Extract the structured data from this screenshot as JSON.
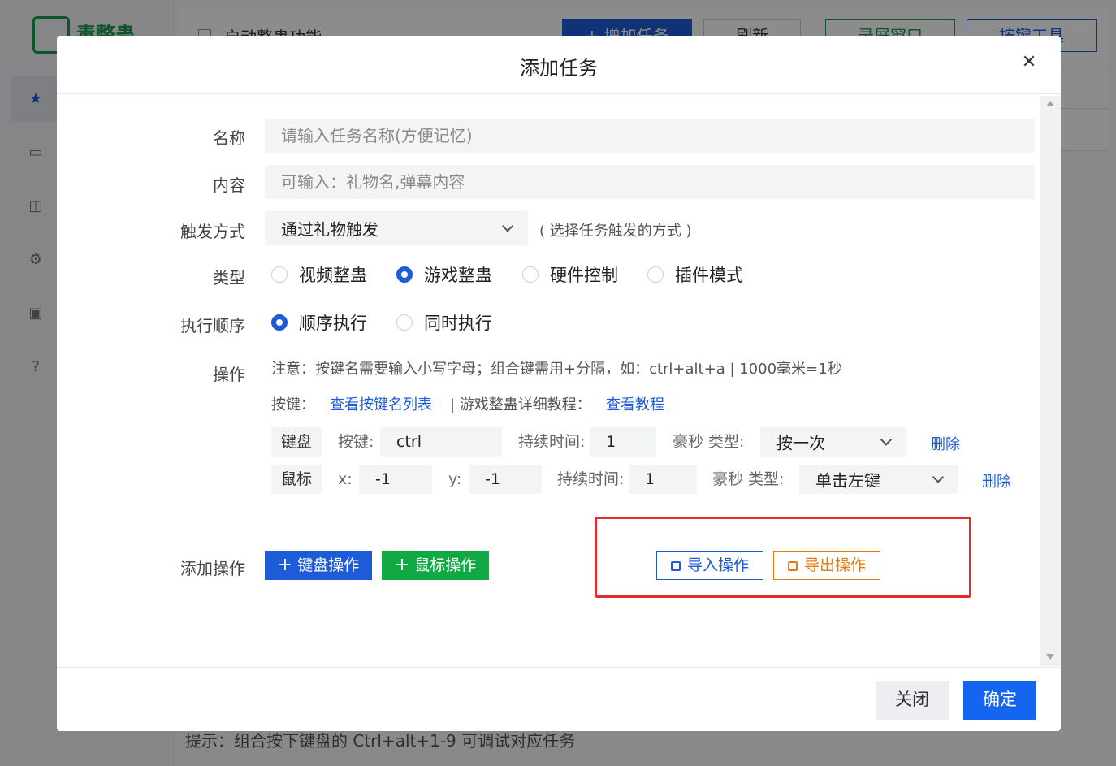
{
  "background": {
    "logo_text": "毒整蛊",
    "enable_label": "启动整蛊功能",
    "btn_add": "+ 增加任务",
    "btn_refresh": "刷新",
    "btn_record": "录屏窗口",
    "btn_keytool": "按键工具",
    "hint": "提示：组合按下键盘的 Ctrl+alt+1-9 可调试对应任务"
  },
  "modal": {
    "title": "添加任务",
    "close_icon": "close-icon",
    "name": {
      "label": "名称",
      "placeholder": "请输入任务名称(方便记忆)"
    },
    "content": {
      "label": "内容",
      "placeholder": "可输入：礼物名,弹幕内容"
    },
    "trigger": {
      "label": "触发方式",
      "selected": "通过礼物触发",
      "hint": "( 选择任务触发的方式 )"
    },
    "type": {
      "label": "类型",
      "options": [
        "视频整蛊",
        "游戏整蛊",
        "硬件控制",
        "插件模式"
      ],
      "selected": "游戏整蛊"
    },
    "order": {
      "label": "执行顺序",
      "options": [
        "顺序执行",
        "同时执行"
      ],
      "selected": "顺序执行"
    },
    "operation": {
      "label": "操作",
      "note": "注意：按键名需要输入小写字母；组合键需用+分隔，如：ctrl+alt+a | 1000毫米=1秒",
      "keys_label": "按键：",
      "keys_link": "查看按键名列表",
      "tutorial_label": "| 游戏整蛊详细教程：",
      "tutorial_link": "查看教程",
      "rows": [
        {
          "tag": "键盘",
          "key_label": "按键:",
          "key_value": "ctrl",
          "duration_label": "持续时间:",
          "duration_value": "1",
          "type_label": "豪秒 类型:",
          "type_value": "按一次",
          "delete": "删除"
        },
        {
          "tag": "鼠标",
          "x_label": "x:",
          "x_value": "-1",
          "y_label": "y:",
          "y_value": "-1",
          "duration_label": "持续时间:",
          "duration_value": "1",
          "type_label": "豪秒 类型:",
          "type_value": "单击左键",
          "delete": "删除"
        }
      ]
    },
    "add_operation": {
      "label": "添加操作",
      "keyboard_btn": "键盘操作",
      "mouse_btn": "鼠标操作",
      "import_btn": "导入操作",
      "export_btn": "导出操作"
    },
    "footer": {
      "close": "关闭",
      "ok": "确定"
    }
  },
  "colors": {
    "primary": "#1e5bd8",
    "ok_button": "#1466f0",
    "green": "#12a944",
    "orange": "#e27a13",
    "highlight": "#e52b2b"
  }
}
